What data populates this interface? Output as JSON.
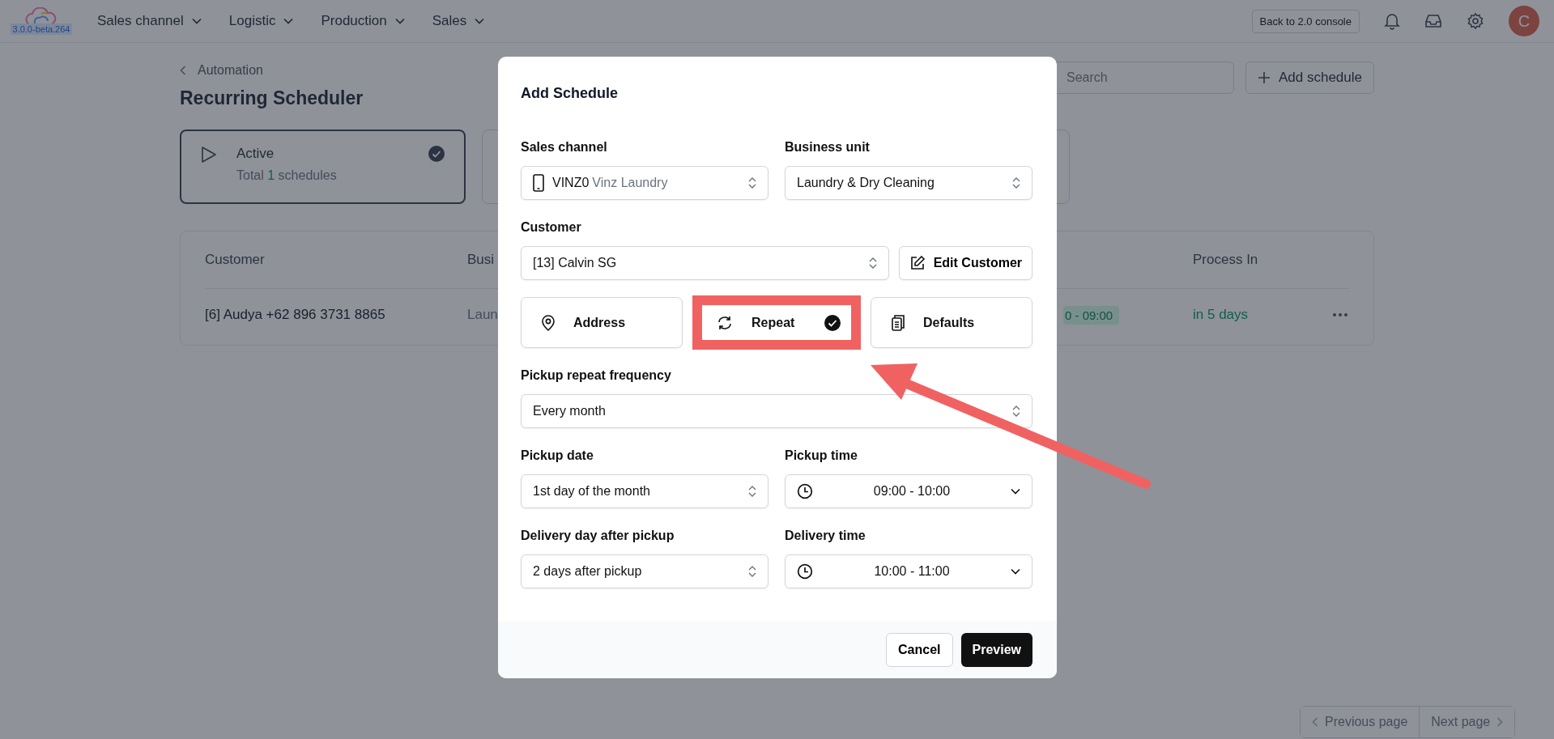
{
  "nav": {
    "version": "3.0.0-beta.264",
    "menus": [
      {
        "label": "Sales channel"
      },
      {
        "label": "Logistic"
      },
      {
        "label": "Production"
      },
      {
        "label": "Sales"
      }
    ],
    "console_button": "Back to 2.0 console",
    "avatar": "C"
  },
  "page": {
    "breadcrumb": "Automation",
    "title": "Recurring Scheduler",
    "search": {
      "placeholder": "Search"
    },
    "add_button": "Add schedule",
    "status_card": {
      "label": "Active",
      "total_prefix": "Total",
      "count": "1",
      "total_suffix": "schedules",
      "selected": true
    },
    "table": {
      "columns": [
        "Customer",
        "Busi",
        "Process In"
      ],
      "rows": [
        {
          "customer": "[6] Audya +62 896 3731 8865",
          "column_2": "Laun",
          "time_tag": "0 - 09:00",
          "process_in": "in 5 days"
        }
      ]
    },
    "pagination": {
      "previous": "Previous page",
      "next": "Next page"
    }
  },
  "modal": {
    "title": "Add Schedule",
    "sales_channel": {
      "label": "Sales channel",
      "code": "VINZ0",
      "name": "Vinz Laundry"
    },
    "business_unit": {
      "label": "Business unit",
      "value": "Laundry & Dry Cleaning"
    },
    "customer": {
      "label": "Customer",
      "value": "[13] Calvin SG",
      "edit_button": "Edit Customer"
    },
    "sections": [
      {
        "label": "Address",
        "selected": false,
        "highlighted": false
      },
      {
        "label": "Repeat",
        "selected": true,
        "highlighted": true
      },
      {
        "label": "Defaults",
        "selected": false,
        "highlighted": false
      }
    ],
    "frequency": {
      "label": "Pickup repeat frequency",
      "value": "Every month"
    },
    "pickup_date": {
      "label": "Pickup date",
      "value": "1st day of the month"
    },
    "pickup_time": {
      "label": "Pickup time",
      "value": "09:00 - 10:00"
    },
    "delivery_day": {
      "label": "Delivery day after pickup",
      "value": "2 days after pickup"
    },
    "delivery_time": {
      "label": "Delivery time",
      "value": "10:00 - 11:00"
    },
    "buttons": {
      "cancel": "Cancel",
      "preview": "Preview"
    }
  }
}
